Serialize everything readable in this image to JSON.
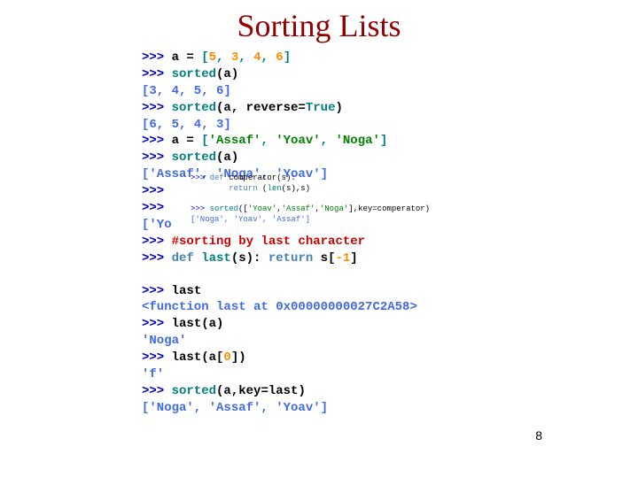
{
  "title": "Sorting Lists",
  "page_number": "8",
  "lines": [
    {
      "type": "cmd",
      "segments": [
        {
          "cls": "prompt",
          "t": ">>> "
        },
        {
          "cls": "black",
          "t": "a = "
        },
        {
          "cls": "teal",
          "t": "["
        },
        {
          "cls": "orange",
          "t": "5"
        },
        {
          "cls": "teal",
          "t": ", "
        },
        {
          "cls": "orange",
          "t": "3"
        },
        {
          "cls": "teal",
          "t": ", "
        },
        {
          "cls": "orange",
          "t": "4"
        },
        {
          "cls": "teal",
          "t": ", "
        },
        {
          "cls": "orange",
          "t": "6"
        },
        {
          "cls": "teal",
          "t": "]"
        }
      ]
    },
    {
      "type": "cmd",
      "segments": [
        {
          "cls": "prompt",
          "t": ">>> "
        },
        {
          "cls": "teal",
          "t": "sorted"
        },
        {
          "cls": "black",
          "t": "(a)"
        }
      ]
    },
    {
      "type": "out",
      "segments": [
        {
          "cls": "royal",
          "t": "[3, 4, 5, 6]"
        }
      ]
    },
    {
      "type": "cmd",
      "segments": [
        {
          "cls": "prompt",
          "t": ">>> "
        },
        {
          "cls": "teal",
          "t": "sorted"
        },
        {
          "cls": "black",
          "t": "(a, reverse="
        },
        {
          "cls": "teal",
          "t": "True"
        },
        {
          "cls": "black",
          "t": ")"
        }
      ]
    },
    {
      "type": "out",
      "segments": [
        {
          "cls": "royal",
          "t": "[6, 5, 4, 3]"
        }
      ]
    },
    {
      "type": "cmd",
      "segments": [
        {
          "cls": "prompt",
          "t": ">>> "
        },
        {
          "cls": "black",
          "t": "a = "
        },
        {
          "cls": "teal",
          "t": "["
        },
        {
          "cls": "green",
          "t": "'Assaf'"
        },
        {
          "cls": "teal",
          "t": ", "
        },
        {
          "cls": "green",
          "t": "'Yoav'"
        },
        {
          "cls": "teal",
          "t": ", "
        },
        {
          "cls": "green",
          "t": "'Noga'"
        },
        {
          "cls": "teal",
          "t": "]"
        }
      ]
    },
    {
      "type": "cmd",
      "segments": [
        {
          "cls": "prompt",
          "t": ">>> "
        },
        {
          "cls": "teal",
          "t": "sorted"
        },
        {
          "cls": "black",
          "t": "(a)"
        }
      ]
    },
    {
      "type": "out",
      "segments": [
        {
          "cls": "royal",
          "t": "['Assaf', 'Noga', 'Yoav']"
        }
      ]
    },
    {
      "type": "cmd",
      "segments": [
        {
          "cls": "prompt",
          "t": ">>> "
        }
      ]
    },
    {
      "type": "cmd",
      "segments": [
        {
          "cls": "prompt",
          "t": ">>> "
        }
      ]
    },
    {
      "type": "out",
      "segments": [
        {
          "cls": "royal",
          "t": "['Yo"
        }
      ]
    },
    {
      "type": "cmd",
      "segments": [
        {
          "cls": "prompt",
          "t": ">>> "
        },
        {
          "cls": "red",
          "t": "#sorting by last character"
        }
      ]
    },
    {
      "type": "cmd",
      "segments": [
        {
          "cls": "prompt",
          "t": ">>> "
        },
        {
          "cls": "steelblue",
          "t": "def "
        },
        {
          "cls": "teal",
          "t": "last"
        },
        {
          "cls": "black",
          "t": "(s): "
        },
        {
          "cls": "steelblue",
          "t": "return"
        },
        {
          "cls": "black",
          "t": " s["
        },
        {
          "cls": "orange",
          "t": "-1"
        },
        {
          "cls": "black",
          "t": "]"
        }
      ]
    },
    {
      "type": "gap"
    },
    {
      "type": "cmd",
      "segments": [
        {
          "cls": "prompt",
          "t": ">>> "
        },
        {
          "cls": "black",
          "t": "last"
        }
      ]
    },
    {
      "type": "out",
      "segments": [
        {
          "cls": "royal",
          "t": "<function last at 0x00000000027C2A58>"
        }
      ]
    },
    {
      "type": "cmd",
      "segments": [
        {
          "cls": "prompt",
          "t": ">>> "
        },
        {
          "cls": "black",
          "t": "last(a)"
        }
      ]
    },
    {
      "type": "out",
      "segments": [
        {
          "cls": "royal",
          "t": "'Noga'"
        }
      ]
    },
    {
      "type": "cmd",
      "segments": [
        {
          "cls": "prompt",
          "t": ">>> "
        },
        {
          "cls": "black",
          "t": "last(a["
        },
        {
          "cls": "orange",
          "t": "0"
        },
        {
          "cls": "black",
          "t": "])"
        }
      ]
    },
    {
      "type": "out",
      "segments": [
        {
          "cls": "royal",
          "t": "'f'"
        }
      ]
    },
    {
      "type": "cmd",
      "segments": [
        {
          "cls": "prompt",
          "t": ">>> "
        },
        {
          "cls": "teal",
          "t": "sorted"
        },
        {
          "cls": "black",
          "t": "(a,key=last)"
        }
      ]
    },
    {
      "type": "out",
      "segments": [
        {
          "cls": "royal",
          "t": "['Noga', 'Assaf', 'Yoav']"
        }
      ]
    }
  ],
  "overlay": {
    "lines": [
      {
        "segments": [
          {
            "cls": "prompt",
            "t": ">>> "
          },
          {
            "cls": "steelblue",
            "t": "def "
          },
          {
            "cls": "black",
            "t": "comperator(s):"
          }
        ]
      },
      {
        "segments": [
          {
            "cls": "black",
            "t": "        "
          },
          {
            "cls": "steelblue",
            "t": "return"
          },
          {
            "cls": "black",
            "t": " ("
          },
          {
            "cls": "teal",
            "t": "len"
          },
          {
            "cls": "black",
            "t": "(s),s)"
          }
        ]
      },
      {
        "segments": [
          {
            "cls": "black",
            "t": " "
          }
        ]
      },
      {
        "segments": [
          {
            "cls": "prompt",
            "t": ">>> "
          },
          {
            "cls": "teal",
            "t": "sorted"
          },
          {
            "cls": "black",
            "t": "(["
          },
          {
            "cls": "green",
            "t": "'Yoav'"
          },
          {
            "cls": "black",
            "t": ","
          },
          {
            "cls": "green",
            "t": "'Assaf'"
          },
          {
            "cls": "black",
            "t": ","
          },
          {
            "cls": "green",
            "t": "'Noga'"
          },
          {
            "cls": "black",
            "t": "],key=comperator)"
          }
        ]
      },
      {
        "segments": [
          {
            "cls": "royal",
            "t": "['Noga', 'Yoav', 'Assaf']"
          }
        ]
      }
    ]
  }
}
